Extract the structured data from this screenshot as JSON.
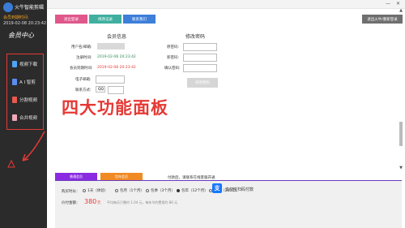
{
  "app": {
    "title": "火牛智能剪辑"
  },
  "vip": {
    "label": "会员到期时间:",
    "date": "2019-02-08 20:23:42"
  },
  "sidebar": {
    "center_title": "会员中心",
    "items": [
      {
        "label": "视频下载",
        "icon": "download-video-icon",
        "color": "#4fa3f7"
      },
      {
        "label": "A I 智剪",
        "icon": "ai-edit-icon",
        "color": "#5a8cf0"
      },
      {
        "label": "分割视频",
        "icon": "split-video-icon",
        "color": "#e85a4f"
      },
      {
        "label": "合并视频",
        "icon": "merge-video-icon",
        "color": "#f0a8b8"
      }
    ]
  },
  "window": {
    "minimize": "—",
    "close": "✕"
  },
  "tabs": [
    {
      "label": "退出登录",
      "color": "#e0578b"
    },
    {
      "label": "修改记录",
      "color": "#3fb0a0"
    },
    {
      "label": "联系我们",
      "color": "#3d7fd9"
    }
  ],
  "top_right_button": "退出火牛/重新登录",
  "member_info": {
    "title": "会员信息",
    "fields": {
      "user_label": "用户名/邮箱:",
      "register_label": "注册时间:",
      "register_value": "2019-02-08 20:23:42",
      "expire_label": "会员到期时间:",
      "expire_value": "2019-02-08 20:23:42",
      "email_label": "电子邮箱:",
      "contact_label": "联系方式:",
      "contact_select": "QQ"
    }
  },
  "change_password": {
    "title": "修改密码",
    "old_label": "原密码:",
    "new_label": "新密码:",
    "confirm_label": "确认密码:",
    "button": "修改密码"
  },
  "annotation": "四大功能面板",
  "payment": {
    "tabs": [
      {
        "label": "普通会员",
        "color": "#8a2be2"
      },
      {
        "label": "包年会员",
        "color": "#f08a24"
      }
    ],
    "note": "付款后，请联系在线客服开通",
    "duration_label": "购买时长：",
    "options": [
      {
        "label": "1天（体验）",
        "checked": false
      },
      {
        "label": "包月（1个月）",
        "checked": false
      },
      {
        "label": "包季（3个月）",
        "checked": false
      },
      {
        "label": "包年（12个月）",
        "checked": true
      },
      {
        "label": "永久（100年）",
        "checked": false
      }
    ],
    "price_label": "价付金额：",
    "price_value": "380",
    "price_unit": "元",
    "price_desc": "平均每天只需约 1.04 元，每年节约费用约 80 元",
    "method_label": "支付宝扫码付款",
    "method_icon": "alipay-icon"
  }
}
